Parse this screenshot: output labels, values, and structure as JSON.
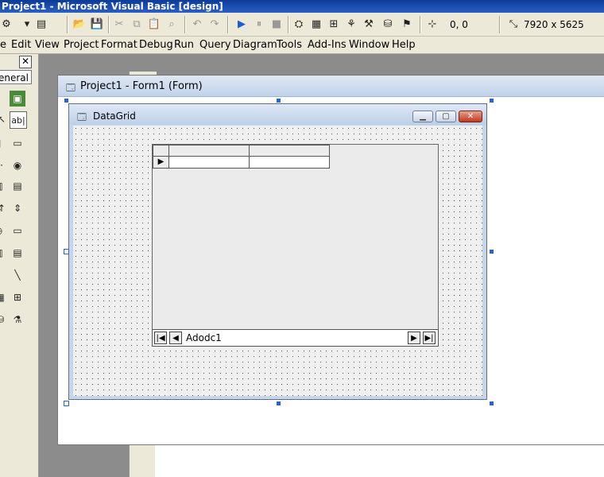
{
  "app": {
    "title": "Project1 - Microsoft Visual Basic [design]"
  },
  "toolbar": {
    "position_readout": "0, 0",
    "size_readout": "7920 x 5625"
  },
  "menu": {
    "items": [
      "e",
      "Edit",
      "View",
      "Project",
      "Format",
      "Debug",
      "Run",
      "Query",
      "Diagram",
      "Tools",
      "Add-Ins",
      "Window",
      "Help"
    ]
  },
  "toolbox": {
    "tab_label": "eneral",
    "close_label": "✕"
  },
  "form_window": {
    "title": "Project1 - Form1 (Form)"
  },
  "form": {
    "caption": "DataGrid"
  },
  "adodc": {
    "caption": "Adodc1"
  }
}
